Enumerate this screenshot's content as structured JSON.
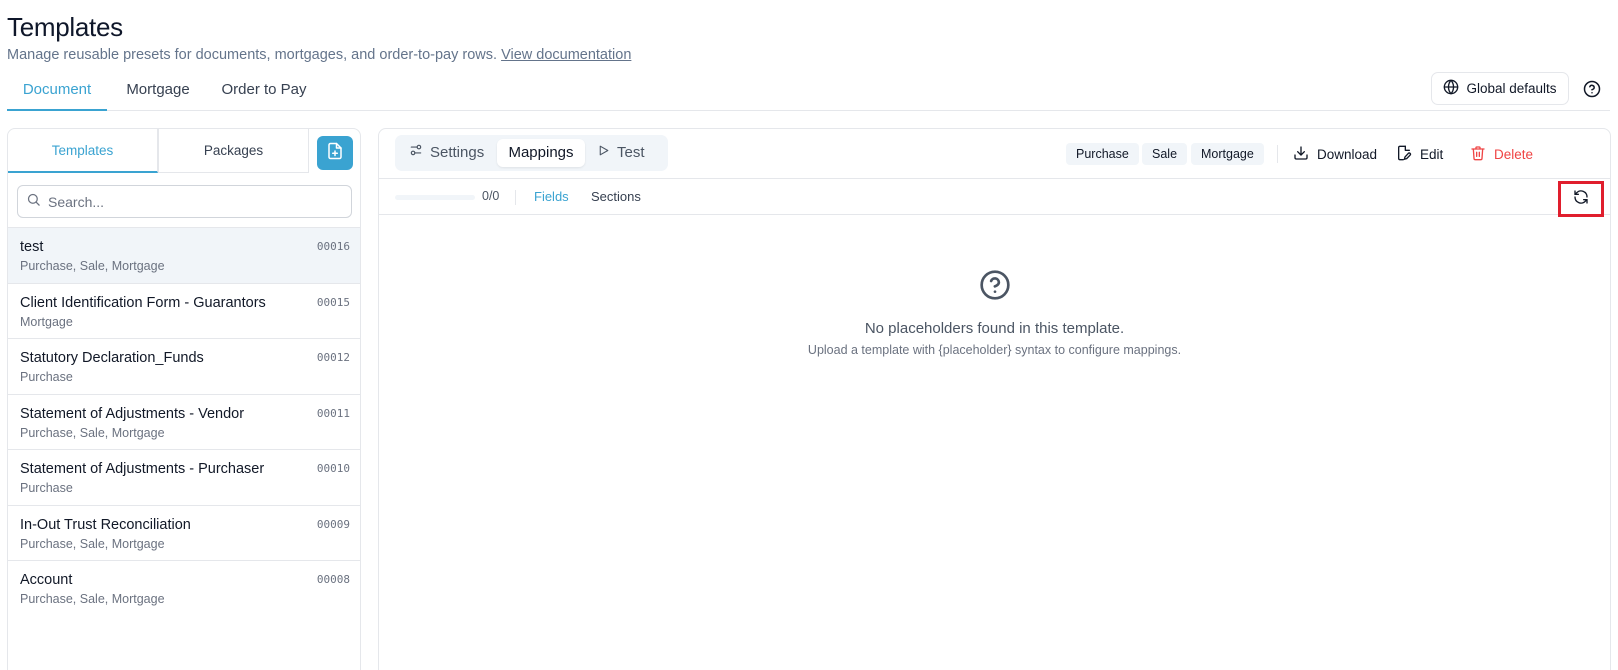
{
  "header": {
    "title": "Templates",
    "subtitle": "Manage reusable presets for documents, mortgages, and order-to-pay rows.",
    "doc_link": "View documentation"
  },
  "top_tabs": [
    {
      "label": "Document",
      "active": true
    },
    {
      "label": "Mortgage",
      "active": false
    },
    {
      "label": "Order to Pay",
      "active": false
    }
  ],
  "global_defaults_label": "Global defaults",
  "left_panel": {
    "tabs": [
      {
        "label": "Templates",
        "active": true
      },
      {
        "label": "Packages",
        "active": false
      }
    ],
    "new_icon": "file-plus-icon",
    "search_placeholder": "Search...",
    "items": [
      {
        "name": "test",
        "tags": "Purchase, Sale, Mortgage",
        "id": "00016",
        "selected": true
      },
      {
        "name": "Client Identification Form - Guarantors",
        "tags": "Mortgage",
        "id": "00015",
        "selected": false
      },
      {
        "name": "Statutory Declaration_Funds",
        "tags": "Purchase",
        "id": "00012",
        "selected": false
      },
      {
        "name": "Statement of Adjustments - Vendor",
        "tags": "Purchase, Sale, Mortgage",
        "id": "00011",
        "selected": false
      },
      {
        "name": "Statement of Adjustments - Purchaser",
        "tags": "Purchase",
        "id": "00010",
        "selected": false
      },
      {
        "name": "In-Out Trust Reconciliation",
        "tags": "Purchase, Sale, Mortgage",
        "id": "00009",
        "selected": false
      },
      {
        "name": "Account",
        "tags": "Purchase, Sale, Mortgage",
        "id": "00008",
        "selected": false
      }
    ]
  },
  "right_panel": {
    "segments": [
      {
        "label": "Settings",
        "icon": "sliders-icon",
        "active": false
      },
      {
        "label": "Mappings",
        "icon": "",
        "active": true
      },
      {
        "label": "Test",
        "icon": "play-icon",
        "active": false
      }
    ],
    "chips": [
      "Purchase",
      "Sale",
      "Mortgage"
    ],
    "actions": {
      "download": "Download",
      "edit": "Edit",
      "delete": "Delete"
    },
    "progress": {
      "text": "0/0",
      "fraction": 0
    },
    "subtabs": [
      {
        "label": "Fields",
        "active": true
      },
      {
        "label": "Sections",
        "active": false
      }
    ],
    "refresh_icon": "refresh-icon",
    "empty": {
      "title": "No placeholders found in this template.",
      "subtitle": "Upload a template with {placeholder} syntax to configure mappings."
    }
  },
  "colors": {
    "accent": "#3aa3d1",
    "danger": "#ef4444",
    "highlight": "#e01e2d"
  }
}
